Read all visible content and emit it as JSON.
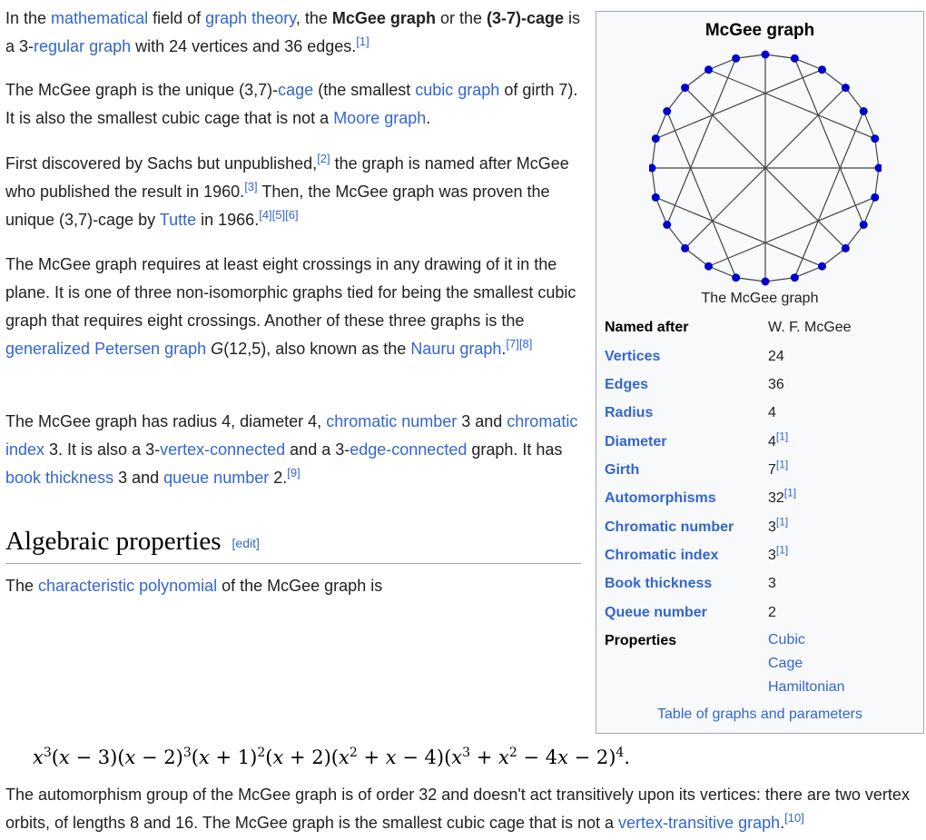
{
  "intro": {
    "t1": "In the ",
    "l1": "mathematical",
    "t2": " field of ",
    "l2": "graph theory",
    "t3": ", the ",
    "b1": "McGee graph",
    "t4": " or the ",
    "b2": "(3-7)-cage",
    "t5": " is a 3-",
    "l3": "regular graph",
    "t6": " with 24 vertices and 36 edges.",
    "ref1": "[1]"
  },
  "para2": {
    "t1": "The McGee graph is the unique (3,7)-",
    "l1": "cage",
    "t2": " (the smallest ",
    "l2": "cubic graph",
    "t3": " of girth 7). It is also the smallest cubic cage that is not a ",
    "l3": "Moore graph",
    "t4": "."
  },
  "para3": {
    "t1": "First discovered by Sachs but unpublished,",
    "ref2": "[2]",
    "t2": " the graph is named after McGee who published the result in 1960.",
    "ref3": "[3]",
    "t3": " Then, the McGee graph was proven the unique (3,7)-cage by ",
    "l1": "Tutte",
    "t4": " in 1966.",
    "ref4": "[4][5][6]"
  },
  "para4": {
    "t1": "The McGee graph requires at least eight crossings in any drawing of it in the plane. It is one of three non-isomorphic graphs tied for being the smallest cubic graph that requires eight crossings. Another of these three graphs is the ",
    "l1": "generalized Petersen graph",
    "t2": " ",
    "g": "G",
    "t3": "(12,5), also known as the ",
    "l2": "Nauru graph",
    "t4": ".",
    "ref": "[7][8]"
  },
  "para5": {
    "t1": "The McGee graph has radius 4, diameter 4, ",
    "l1": "chromatic number",
    "t2": " 3 and ",
    "l2": "chromatic index",
    "t3": " 3. It is also a 3-",
    "l3": "vertex-connected",
    "t4": " and a 3-",
    "l4": "edge-connected",
    "t5": " graph. It has ",
    "l5": "book thickness",
    "t6": " 3 and ",
    "l6": "queue number",
    "t7": " 2.",
    "ref": "[9]"
  },
  "section": {
    "heading": "Algebraic properties",
    "edit": "[edit]"
  },
  "para6": {
    "t1": "The ",
    "l1": "characteristic polynomial",
    "t2": " of the McGee graph is"
  },
  "para7": {
    "t1": "The automorphism group of the McGee graph is of order 32 and doesn't act transitively upon its vertices: there are two vertex orbits, of lengths 8 and 16. The McGee graph is the smallest cubic cage that is not a ",
    "l1": "vertex-transitive graph",
    "t2": ".",
    "ref": "[10]"
  },
  "infobox": {
    "title": "McGee graph",
    "caption": "The McGee graph",
    "rows": [
      {
        "label": "Named after",
        "value": "W. F. McGee",
        "ref": ""
      },
      {
        "label": "Vertices",
        "value": "24",
        "ref": ""
      },
      {
        "label": "Edges",
        "value": "36",
        "ref": ""
      },
      {
        "label": "Radius",
        "value": "4",
        "ref": ""
      },
      {
        "label": "Diameter",
        "value": "4",
        "ref": "[1]"
      },
      {
        "label": "Girth",
        "value": "7",
        "ref": "[1]"
      },
      {
        "label": "Automorphisms",
        "value": "32",
        "ref": "[1]"
      },
      {
        "label": "Chromatic number",
        "value": "3",
        "ref": "[1]"
      },
      {
        "label": "Chromatic index",
        "value": "3",
        "ref": "[1]"
      },
      {
        "label": "Book thickness",
        "value": "3",
        "ref": ""
      },
      {
        "label": "Queue number",
        "value": "2",
        "ref": ""
      }
    ],
    "properties_label": "Properties",
    "properties": [
      "Cubic",
      "Cage",
      "Hamiltonian"
    ],
    "footer": "Table of graphs and parameters"
  },
  "graph": {
    "vertex_count": 24,
    "chords": [
      [
        0,
        12
      ],
      [
        1,
        8
      ],
      [
        2,
        19
      ],
      [
        3,
        15
      ],
      [
        4,
        11
      ],
      [
        5,
        22
      ],
      [
        6,
        18
      ],
      [
        7,
        14
      ],
      [
        9,
        21
      ],
      [
        10,
        17
      ],
      [
        13,
        20
      ],
      [
        16,
        23
      ]
    ],
    "vertex_color": "#0000cc",
    "edge_color": "#444444"
  },
  "colors": {
    "link": "#3366cc",
    "infobox_bg": "#f8f9fa",
    "border": "#a2a9b1"
  }
}
